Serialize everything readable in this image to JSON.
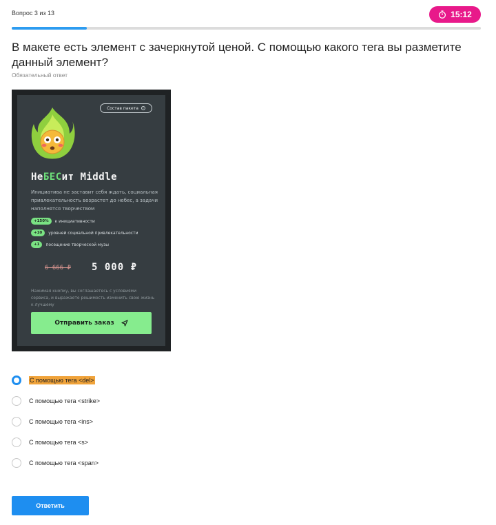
{
  "header": {
    "question_counter": "Вопрос 3 из 13",
    "timer": "15:12",
    "timer_icon": "stopwatch-icon",
    "progress_percent": 16
  },
  "question": {
    "text": "В макете есть элемент с зачеркнутой ценой. С помощью какого тега вы разметите данный элемент?",
    "required_label": "Обязательный ответ"
  },
  "mockup": {
    "package_button": "Состав пакета",
    "title_prefix": "Не",
    "title_accent": "БЕС",
    "title_suffix": "ит Middle",
    "description": "Инициатива не заставит себя ждать, социальная привлекательность возрастет до небес, а задачи наполнятся творчеством",
    "perks": [
      {
        "badge": "+150%",
        "text": "к инициативности"
      },
      {
        "badge": "+10",
        "text": "уровней социальной привлекательности"
      },
      {
        "badge": "+1",
        "text": "посещение творческой музы"
      }
    ],
    "old_price": "6 666 ₽",
    "new_price": "5 000 ₽",
    "legal": "Нажимая кнопку, вы соглашаетесь с условиями сервиса, и выражаете решимость изменить свою жизнь к лучшему",
    "order_button": "Отправить заказ",
    "colors": {
      "card_bg": "#363d41",
      "accent_green": "#86ec8e",
      "old_price": "#d1918c"
    }
  },
  "options": [
    {
      "label": "С помощью тега <del>",
      "selected": true
    },
    {
      "label": "С помощью тега <strike>",
      "selected": false
    },
    {
      "label": "С помощью тега <ins>",
      "selected": false
    },
    {
      "label": "С помощью тега <s>",
      "selected": false
    },
    {
      "label": "С помощью тега <span>",
      "selected": false
    }
  ],
  "submit_label": "Ответить",
  "colors": {
    "accent": "#1e8ef0",
    "timer_bg": "#e8198a",
    "highlight": "#f0a33a"
  }
}
